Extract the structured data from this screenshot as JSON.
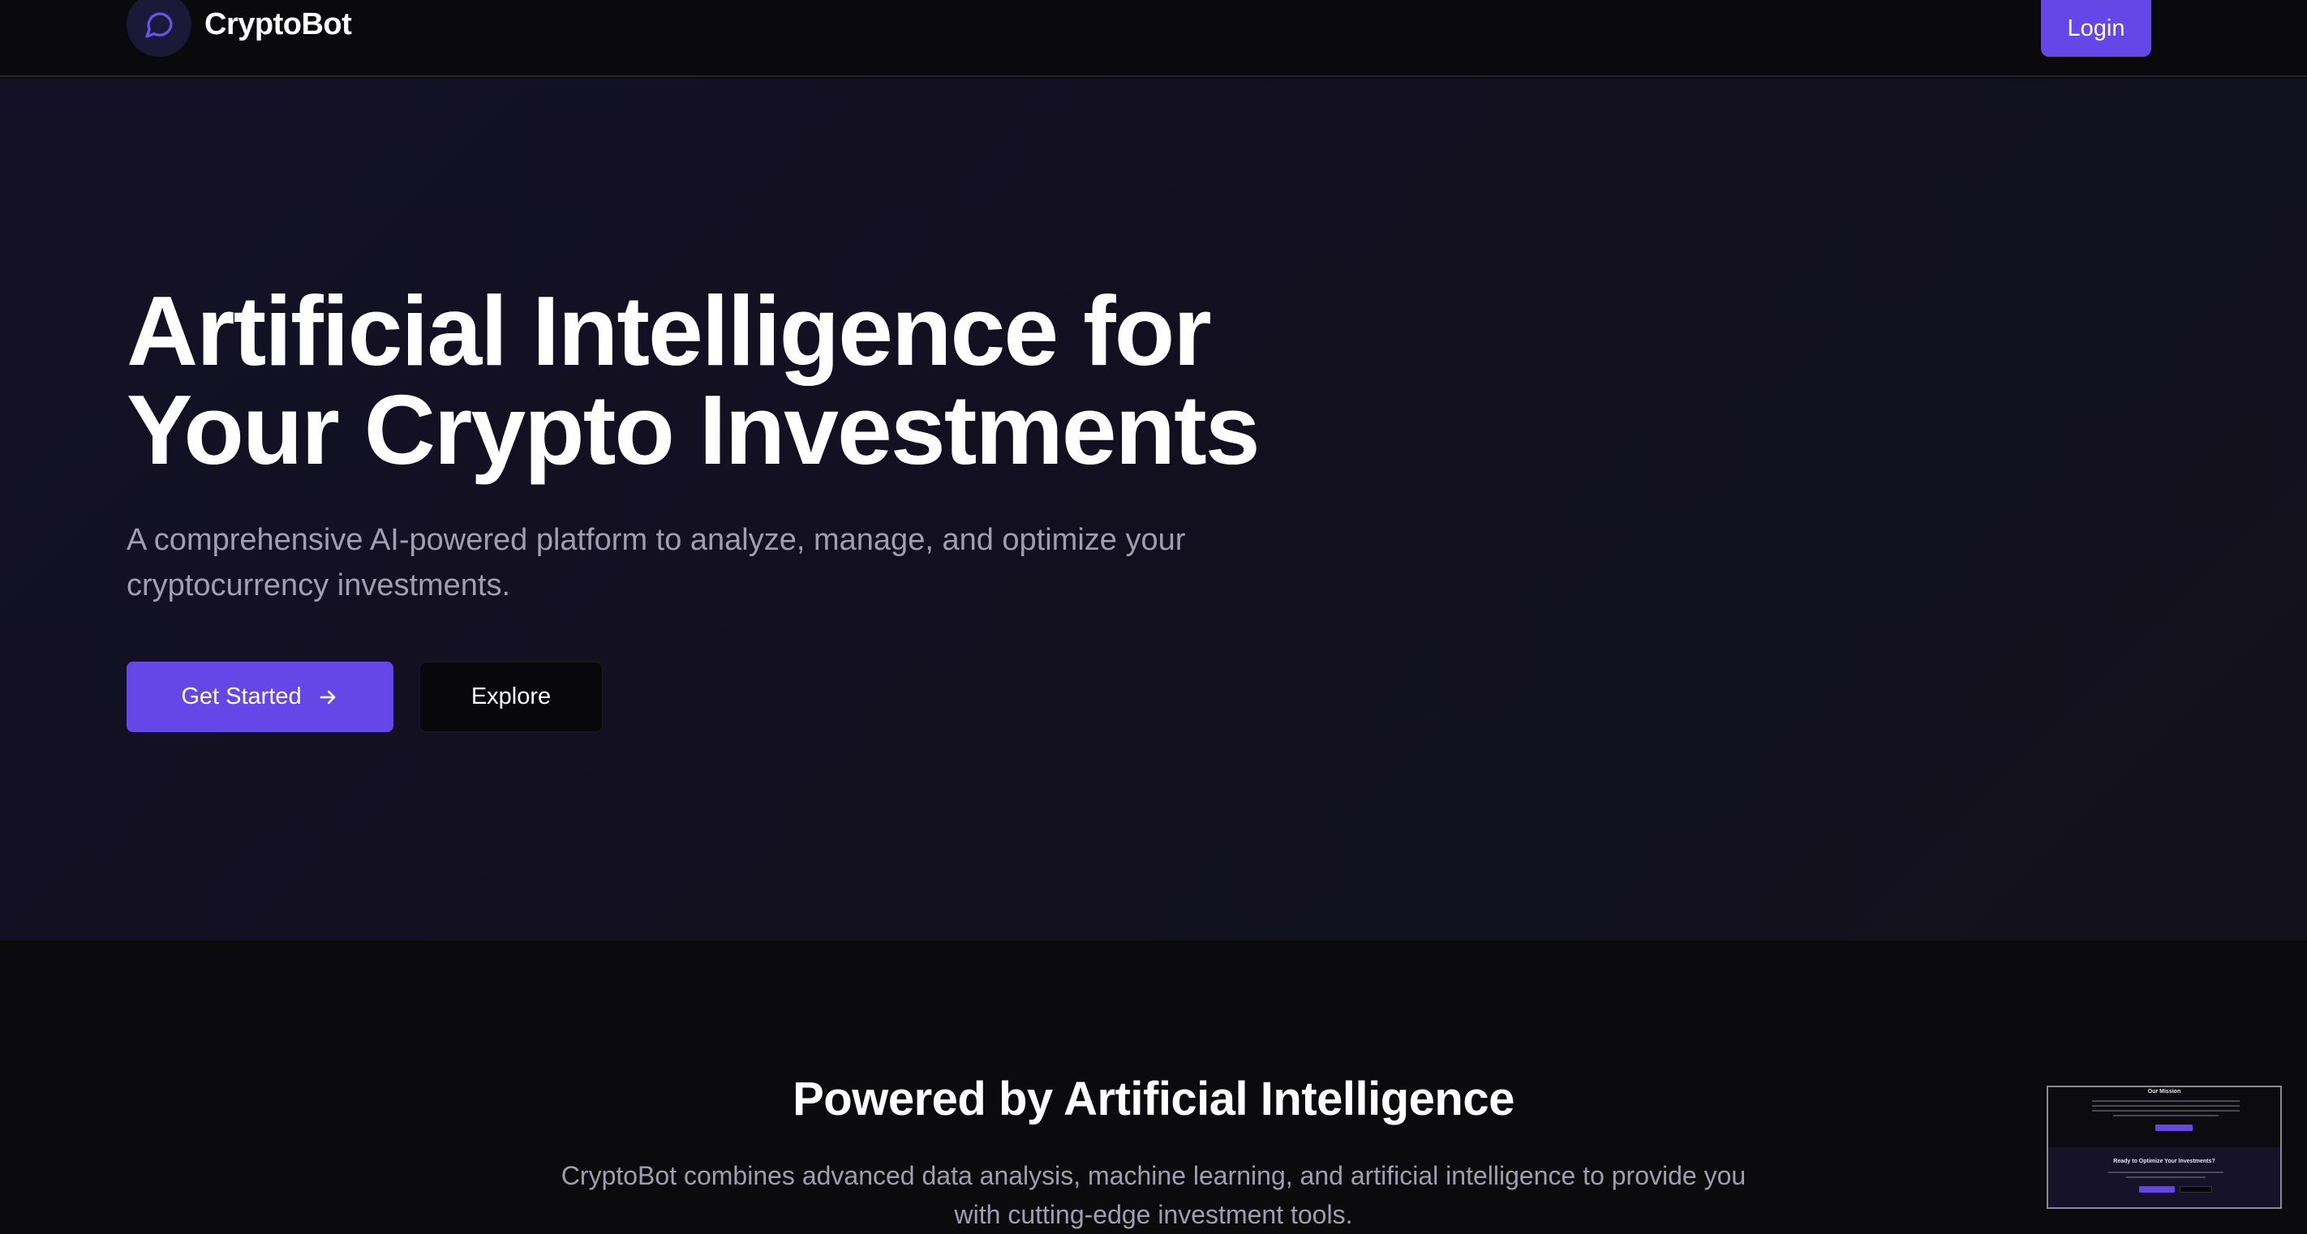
{
  "header": {
    "brand_name": "CryptoBot",
    "logo_icon": "chat-bubble-icon",
    "login_label": "Login"
  },
  "hero": {
    "title_line1": "Artificial Intelligence for",
    "title_line2": "Your Crypto Investments",
    "subtitle_line1": "A comprehensive AI-powered platform to analyze, manage, and optimize your",
    "subtitle_line2": "cryptocurrency investments.",
    "primary_button": "Get Started",
    "primary_button_icon": "arrow-right-icon",
    "secondary_button": "Explore"
  },
  "ai_section": {
    "title": "Powered by Artificial Intelligence",
    "description_line1": "CryptoBot combines advanced data analysis, machine learning, and artificial intelligence to provide you",
    "description_line2": "with cutting-edge investment tools."
  },
  "minimap": {
    "section1_title": "Our Mission",
    "section2_title": "Ready to Optimize Your Investments?"
  },
  "colors": {
    "accent": "#6547e8",
    "background": "#0b0b0e",
    "hero_background": "#13111f",
    "muted_text": "#a09eb0"
  }
}
